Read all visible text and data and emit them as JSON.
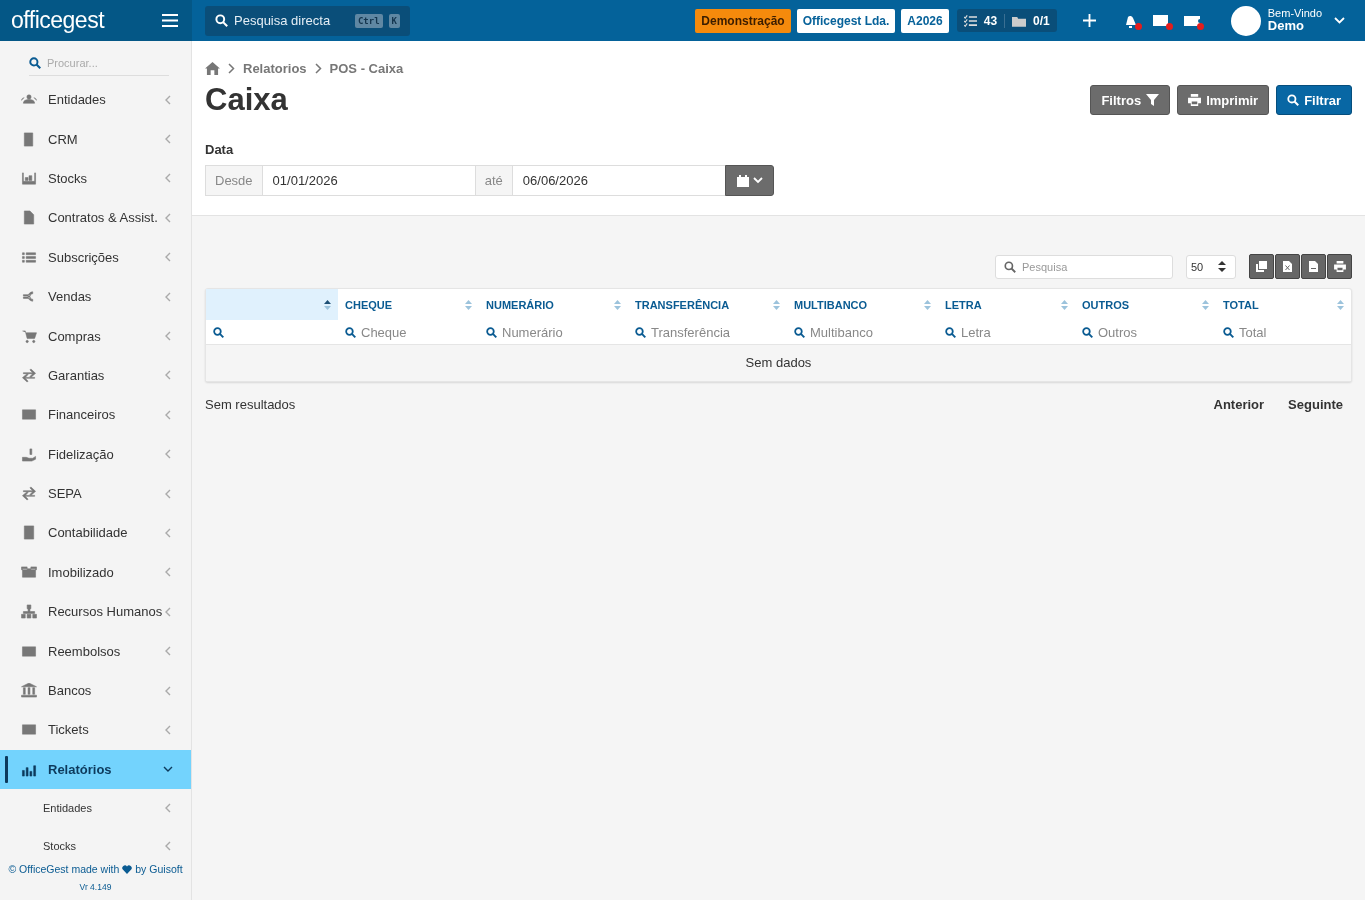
{
  "topbar": {
    "logo": "officegest",
    "search": {
      "placeholder": "Pesquisa directa",
      "keys": [
        "Ctrl",
        "K"
      ]
    },
    "badges": [
      {
        "label": "Demonstração",
        "kind": "warning"
      },
      {
        "label": "Officegest Lda.",
        "kind": "light"
      },
      {
        "label": "A2026",
        "kind": "light"
      }
    ],
    "counters": [
      {
        "value": "43"
      },
      {
        "value": "0/1"
      }
    ],
    "notifications": [
      {
        "unread": true
      },
      {
        "unread": true
      },
      {
        "unread": true
      }
    ],
    "user": {
      "greeting": "Bem-Vindo",
      "name": "Demo"
    }
  },
  "sidebar": {
    "search": {
      "placeholder": "Procurar..."
    },
    "items": [
      {
        "label": "Entidades",
        "selected": false,
        "expanded": false
      },
      {
        "label": "CRM",
        "selected": false,
        "expanded": false
      },
      {
        "label": "Stocks",
        "selected": false,
        "expanded": false
      },
      {
        "label": "Contratos & Assist.",
        "selected": false,
        "expanded": false
      },
      {
        "label": "Subscrições",
        "selected": false,
        "expanded": false
      },
      {
        "label": "Vendas",
        "selected": false,
        "expanded": false
      },
      {
        "label": "Compras",
        "selected": false,
        "expanded": false
      },
      {
        "label": "Garantias",
        "selected": false,
        "expanded": false
      },
      {
        "label": "Financeiros",
        "selected": false,
        "expanded": false
      },
      {
        "label": "Fidelização",
        "selected": false,
        "expanded": false
      },
      {
        "label": "SEPA",
        "selected": false,
        "expanded": false
      },
      {
        "label": "Contabilidade",
        "selected": false,
        "expanded": false
      },
      {
        "label": "Imobilizado",
        "selected": false,
        "expanded": false
      },
      {
        "label": "Recursos Humanos",
        "selected": false,
        "expanded": false
      },
      {
        "label": "Reembolsos",
        "selected": false,
        "expanded": false
      },
      {
        "label": "Bancos",
        "selected": false,
        "expanded": false
      },
      {
        "label": "Tickets",
        "selected": false,
        "expanded": false
      },
      {
        "label": "Relatórios",
        "selected": true,
        "expanded": true,
        "children": [
          {
            "label": "Entidades"
          },
          {
            "label": "Stocks"
          }
        ]
      }
    ],
    "footer": {
      "text_before": "© OfficeGest made with",
      "text_after": "by Guisoft",
      "version": "Vr 4.149"
    }
  },
  "breadcrumb": [
    "Relatorios",
    "POS - Caixa"
  ],
  "page_title": "Caixa",
  "actions": [
    {
      "label": "Filtros",
      "kind": "filter"
    },
    {
      "label": "Imprimir",
      "kind": "print"
    },
    {
      "label": "Filtrar",
      "kind": "search"
    }
  ],
  "date_filter": {
    "label": "Data",
    "from_label": "Desde",
    "from": "01/01/2026",
    "to_label": "até",
    "to": "06/06/2026"
  },
  "table": {
    "search": {
      "placeholder": "Pesquisa"
    },
    "page_size": "50",
    "columns": [
      {
        "sorted": true
      },
      {
        "label": "CHEQUE",
        "sorted": false,
        "filter": "Cheque"
      },
      {
        "label": "NUMERÁRIO",
        "sorted": false,
        "filter": "Numerário"
      },
      {
        "label": "TRANSFERÊNCIA",
        "sorted": false,
        "filter": "Transferência"
      },
      {
        "label": "MULTIBANCO",
        "sorted": false,
        "filter": "Multibanco"
      },
      {
        "label": "LETRA",
        "sorted": false,
        "filter": "Letra"
      },
      {
        "label": "OUTROS",
        "sorted": false,
        "filter": "Outros"
      },
      {
        "label": "TOTAL",
        "sorted": false,
        "filter": "Total"
      }
    ],
    "empty": "Sem dados",
    "info": "Sem resultados",
    "pager": [
      "Anterior",
      "Seguinte"
    ]
  }
}
